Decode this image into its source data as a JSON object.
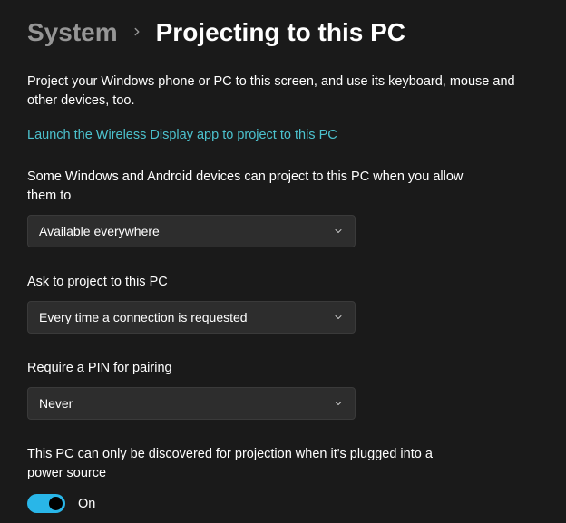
{
  "breadcrumb": {
    "parent": "System",
    "current": "Projecting to this PC"
  },
  "description": "Project your Windows phone or PC to this screen, and use its keyboard, mouse and other devices, too.",
  "link_text": "Launch the Wireless Display app to project to this PC",
  "settings": {
    "allow_projection": {
      "label": "Some Windows and Android devices can project to this PC when you allow them to",
      "value": "Available everywhere"
    },
    "ask_to_project": {
      "label": "Ask to project to this PC",
      "value": "Every time a connection is requested"
    },
    "require_pin": {
      "label": "Require a PIN for pairing",
      "value": "Never"
    },
    "discovery": {
      "label": "This PC can only be discovered for projection when it's plugged into a power source",
      "toggle_state": "On"
    }
  }
}
